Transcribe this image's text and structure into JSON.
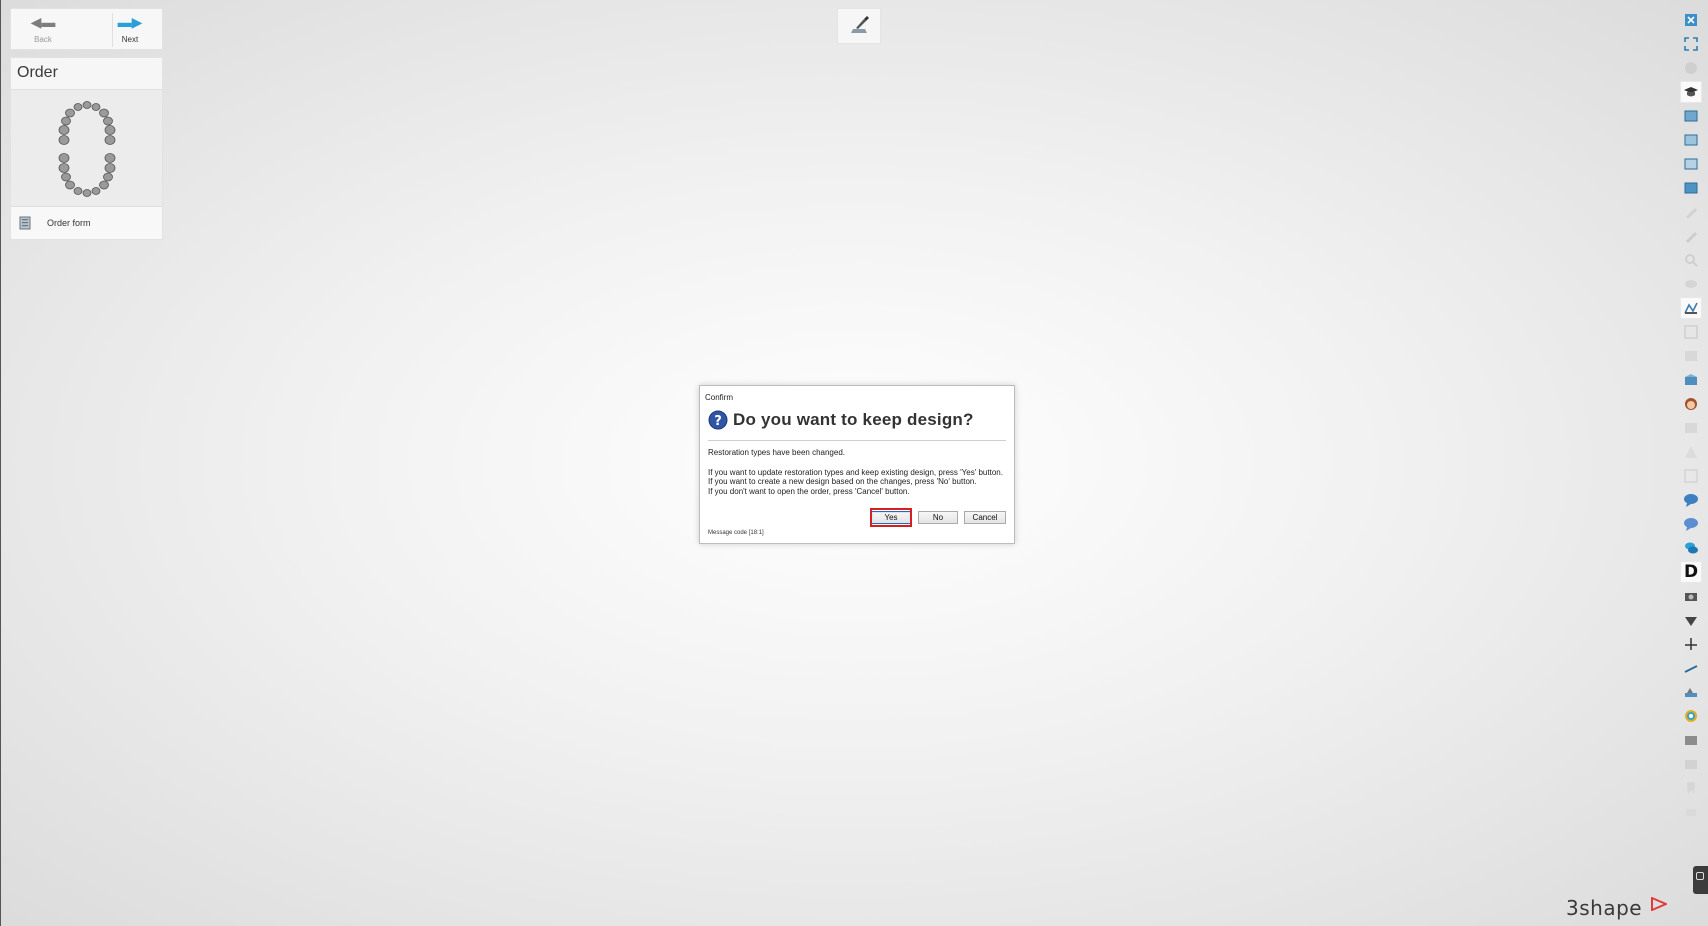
{
  "nav": {
    "back_label": "Back",
    "next_label": "Next"
  },
  "order_panel": {
    "title": "Order",
    "order_form_label": "Order form"
  },
  "dialog": {
    "caption": "Confirm",
    "heading": "Do you want to keep design?",
    "line1": "Restoration types have been changed.",
    "line2": "If you want to update restoration types and keep existing design, press 'Yes' button.",
    "line3": "If you want to create a new design based on the changes, press 'No' button.",
    "line4": "If you don't want to open the order, press 'Cancel' button.",
    "yes_label": "Yes",
    "no_label": "No",
    "cancel_label": "Cancel",
    "message_code": "Message code [18:1]"
  },
  "right_toolbar": {
    "d_label": "D"
  },
  "brand": {
    "logo_text": "3shape",
    "accent_color": "#2aa0d6",
    "highlight_color": "#d81f1f"
  }
}
